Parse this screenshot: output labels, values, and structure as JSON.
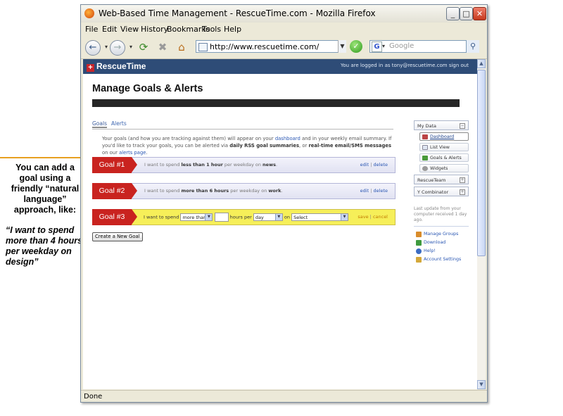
{
  "annotation": {
    "text": "You can add a goal using a friendly “natural language” approach, like:",
    "quote": "“I want to spend more than 4 hours per weekday on design”"
  },
  "window": {
    "title": "Web-Based Time Management - RescueTime.com - Mozilla Firefox",
    "minimize": "_",
    "maximize": "□",
    "close": "✕"
  },
  "menu": [
    "File",
    "Edit",
    "View",
    "History",
    "Bookmarks",
    "Tools",
    "Help"
  ],
  "navbar": {
    "back_icon": "←",
    "forward_icon": "→",
    "url": "http://www.rescuetime.com/",
    "search_placeholder": "Google",
    "search_engine": "G",
    "go_icon": "✓",
    "search_icon": "⚲"
  },
  "status": "Done",
  "site": {
    "logo": "RescueTime",
    "logged_in_prefix": "You are logged in as tony@rescuetime.com",
    "sign_out": "sign out"
  },
  "page": {
    "title": "Manage Goals & Alerts",
    "tabs": [
      "Goals",
      "Alerts"
    ],
    "intro": {
      "p1": "Your goals (and how you are tracking against them) will appear on your",
      "link1": "dashboard",
      "p2": "and in your weekly email summary. If you'd like to track your goals, you can be alerted via",
      "b1": "daily RSS goal summaries",
      "p3": ", or",
      "b2": "real-time email/SMS messages",
      "p4": "on our",
      "link2": "alerts page",
      "p5": "."
    },
    "goals": [
      {
        "tag": "Goal #1",
        "pre": "I want to spend",
        "amount": "less than 1 hour",
        "mid": "per weekday on",
        "target": "news",
        "end": ".",
        "edit": "edit",
        "sep": "|",
        "delete": "delete"
      },
      {
        "tag": "Goal #2",
        "pre": "I want to spend",
        "amount": "more than 6 hours",
        "mid": "per weekday on",
        "target": "work",
        "end": ".",
        "edit": "edit",
        "sep": "|",
        "delete": "delete"
      }
    ],
    "goal_edit": {
      "tag": "Goal #3",
      "pre": "I want to spend",
      "amount_select": "more than",
      "hours_label": "hours per",
      "period_select": "day",
      "on_label": "on",
      "target_select": "Select",
      "save": "save",
      "sep": "|",
      "cancel": "cancel"
    },
    "create_button": "Create a New Goal"
  },
  "sidebar": {
    "my_data": "My Data",
    "items": [
      "Dashboard",
      "List View",
      "Goals & Alerts",
      "Widgets"
    ],
    "groups": [
      "RescueTeam",
      "Y Combinator"
    ],
    "last_update": "Last update from your computer received 1 day ago.",
    "links": [
      "Manage Groups",
      "Download",
      "Help!",
      "Account Settings"
    ],
    "toggle_minus": "−",
    "toggle_plus": "+"
  }
}
